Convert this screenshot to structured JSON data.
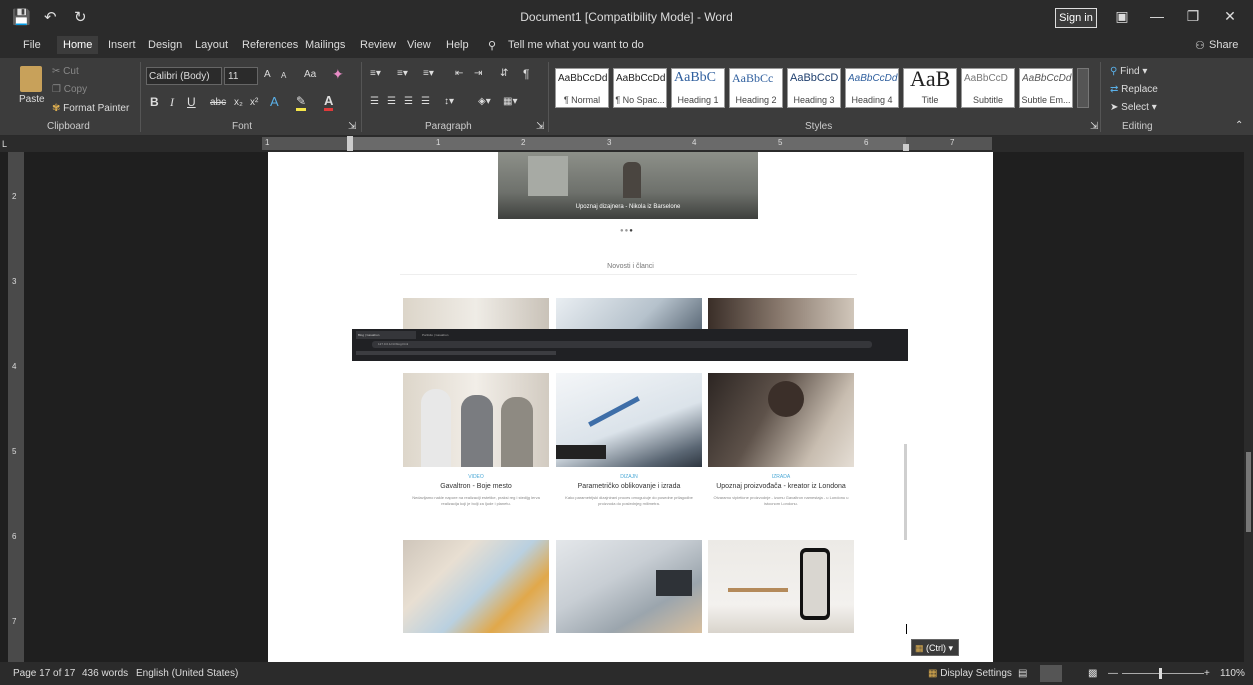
{
  "window": {
    "title": "Document1 [Compatibility Mode] - Word",
    "sign_in": "Sign in",
    "minimize": "—",
    "restore": "❐",
    "close": "✕"
  },
  "quick_access": {
    "save": "💾",
    "undo": "↶",
    "redo": "↻"
  },
  "tabs": [
    "File",
    "Home",
    "Insert",
    "Design",
    "Layout",
    "References",
    "Mailings",
    "Review",
    "View",
    "Help"
  ],
  "active_tab": "Home",
  "tell_me": "Tell me what you want to do",
  "share": "Share",
  "clipboard": {
    "paste": "Paste",
    "cut": "Cut",
    "copy": "Copy",
    "format_painter": "Format Painter",
    "label": "Clipboard"
  },
  "font": {
    "name": "Calibri (Body)",
    "size": "11",
    "label": "Font",
    "grow": "A",
    "shrink": "A",
    "case": "Aa"
  },
  "paragraph": {
    "label": "Paragraph"
  },
  "styles": {
    "label": "Styles",
    "items": [
      {
        "preview": "AaBbCcDd",
        "name": "¶ Normal"
      },
      {
        "preview": "AaBbCcDd",
        "name": "¶ No Spac..."
      },
      {
        "preview": "AaBbC",
        "name": "Heading 1"
      },
      {
        "preview": "AaBbCc",
        "name": "Heading 2"
      },
      {
        "preview": "AaBbCcD",
        "name": "Heading 3"
      },
      {
        "preview": "AaBbCcDd",
        "name": "Heading 4"
      },
      {
        "preview": "AaB",
        "name": "Title"
      },
      {
        "preview": "AaBbCcD",
        "name": "Subtitle"
      },
      {
        "preview": "AaBbCcDd",
        "name": "Subtle Em..."
      }
    ]
  },
  "editing": {
    "label": "Editing",
    "find": "Find",
    "replace": "Replace",
    "select": "Select"
  },
  "ruler": {
    "numbers": [
      "1",
      "1",
      "2",
      "3",
      "4",
      "5",
      "6",
      "7"
    ]
  },
  "vruler": {
    "numbers": [
      "2",
      "3",
      "4",
      "5",
      "6",
      "7"
    ]
  },
  "document": {
    "hero_caption": "Upoznaj dizajnera - Nikola iz Barselone",
    "section_title": "Novosti i članci",
    "browser_tabs": [
      "Blog | Gavaltron",
      "Portfolio | Gavaltron"
    ],
    "browser_url": "127.0.0.1/c/c/blog.html",
    "cards": [
      {
        "category": "VIDEO",
        "title": "Gavaltron - Boje mesto",
        "desc": "Nedavljamo nakle napore na realizaciji estetike, praksi reg i stedijg lerva realizacija koji je bolji za ljude i planetu."
      },
      {
        "category": "DIZAJN",
        "title": "Parametričko oblikovanje i izrada",
        "desc": "Kako parametrijski dizajnirani proces omogućuje do posedne prilagodbe proizvoda do poslednjeg milimetra."
      },
      {
        "category": "IZRADA",
        "title": "Upoznaj proizvođača - kreator iz Londona",
        "desc": "Otvaramo vipleticne proizvodnje - izumu Gavaltron namestaja - u Londonu u istocnom Londonu."
      }
    ],
    "paste_tag": "(Ctrl)"
  },
  "status": {
    "page": "Page 17 of 17",
    "words": "436 words",
    "language": "English (United States)",
    "display_settings": "Display Settings",
    "zoom": "110%"
  }
}
